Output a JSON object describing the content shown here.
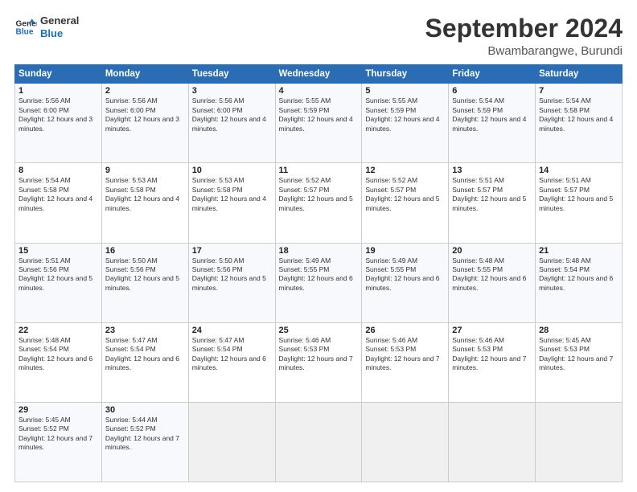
{
  "logo": {
    "line1": "General",
    "line2": "Blue"
  },
  "title": "September 2024",
  "location": "Bwambarangwe, Burundi",
  "days_of_week": [
    "Sunday",
    "Monday",
    "Tuesday",
    "Wednesday",
    "Thursday",
    "Friday",
    "Saturday"
  ],
  "weeks": [
    [
      {
        "day": 1,
        "sunrise": "5:56 AM",
        "sunset": "6:00 PM",
        "daylight": "12 hours and 3 minutes."
      },
      {
        "day": 2,
        "sunrise": "5:56 AM",
        "sunset": "6:00 PM",
        "daylight": "12 hours and 3 minutes."
      },
      {
        "day": 3,
        "sunrise": "5:56 AM",
        "sunset": "6:00 PM",
        "daylight": "12 hours and 4 minutes."
      },
      {
        "day": 4,
        "sunrise": "5:55 AM",
        "sunset": "5:59 PM",
        "daylight": "12 hours and 4 minutes."
      },
      {
        "day": 5,
        "sunrise": "5:55 AM",
        "sunset": "5:59 PM",
        "daylight": "12 hours and 4 minutes."
      },
      {
        "day": 6,
        "sunrise": "5:54 AM",
        "sunset": "5:59 PM",
        "daylight": "12 hours and 4 minutes."
      },
      {
        "day": 7,
        "sunrise": "5:54 AM",
        "sunset": "5:58 PM",
        "daylight": "12 hours and 4 minutes."
      }
    ],
    [
      {
        "day": 8,
        "sunrise": "5:54 AM",
        "sunset": "5:58 PM",
        "daylight": "12 hours and 4 minutes."
      },
      {
        "day": 9,
        "sunrise": "5:53 AM",
        "sunset": "5:58 PM",
        "daylight": "12 hours and 4 minutes."
      },
      {
        "day": 10,
        "sunrise": "5:53 AM",
        "sunset": "5:58 PM",
        "daylight": "12 hours and 4 minutes."
      },
      {
        "day": 11,
        "sunrise": "5:52 AM",
        "sunset": "5:57 PM",
        "daylight": "12 hours and 5 minutes."
      },
      {
        "day": 12,
        "sunrise": "5:52 AM",
        "sunset": "5:57 PM",
        "daylight": "12 hours and 5 minutes."
      },
      {
        "day": 13,
        "sunrise": "5:51 AM",
        "sunset": "5:57 PM",
        "daylight": "12 hours and 5 minutes."
      },
      {
        "day": 14,
        "sunrise": "5:51 AM",
        "sunset": "5:57 PM",
        "daylight": "12 hours and 5 minutes."
      }
    ],
    [
      {
        "day": 15,
        "sunrise": "5:51 AM",
        "sunset": "5:56 PM",
        "daylight": "12 hours and 5 minutes."
      },
      {
        "day": 16,
        "sunrise": "5:50 AM",
        "sunset": "5:56 PM",
        "daylight": "12 hours and 5 minutes."
      },
      {
        "day": 17,
        "sunrise": "5:50 AM",
        "sunset": "5:56 PM",
        "daylight": "12 hours and 5 minutes."
      },
      {
        "day": 18,
        "sunrise": "5:49 AM",
        "sunset": "5:55 PM",
        "daylight": "12 hours and 6 minutes."
      },
      {
        "day": 19,
        "sunrise": "5:49 AM",
        "sunset": "5:55 PM",
        "daylight": "12 hours and 6 minutes."
      },
      {
        "day": 20,
        "sunrise": "5:48 AM",
        "sunset": "5:55 PM",
        "daylight": "12 hours and 6 minutes."
      },
      {
        "day": 21,
        "sunrise": "5:48 AM",
        "sunset": "5:54 PM",
        "daylight": "12 hours and 6 minutes."
      }
    ],
    [
      {
        "day": 22,
        "sunrise": "5:48 AM",
        "sunset": "5:54 PM",
        "daylight": "12 hours and 6 minutes."
      },
      {
        "day": 23,
        "sunrise": "5:47 AM",
        "sunset": "5:54 PM",
        "daylight": "12 hours and 6 minutes."
      },
      {
        "day": 24,
        "sunrise": "5:47 AM",
        "sunset": "5:54 PM",
        "daylight": "12 hours and 6 minutes."
      },
      {
        "day": 25,
        "sunrise": "5:46 AM",
        "sunset": "5:53 PM",
        "daylight": "12 hours and 7 minutes."
      },
      {
        "day": 26,
        "sunrise": "5:46 AM",
        "sunset": "5:53 PM",
        "daylight": "12 hours and 7 minutes."
      },
      {
        "day": 27,
        "sunrise": "5:46 AM",
        "sunset": "5:53 PM",
        "daylight": "12 hours and 7 minutes."
      },
      {
        "day": 28,
        "sunrise": "5:45 AM",
        "sunset": "5:53 PM",
        "daylight": "12 hours and 7 minutes."
      }
    ],
    [
      {
        "day": 29,
        "sunrise": "5:45 AM",
        "sunset": "5:52 PM",
        "daylight": "12 hours and 7 minutes."
      },
      {
        "day": 30,
        "sunrise": "5:44 AM",
        "sunset": "5:52 PM",
        "daylight": "12 hours and 7 minutes."
      },
      null,
      null,
      null,
      null,
      null
    ]
  ],
  "labels": {
    "sunrise": "Sunrise:",
    "sunset": "Sunset:",
    "daylight": "Daylight:"
  }
}
